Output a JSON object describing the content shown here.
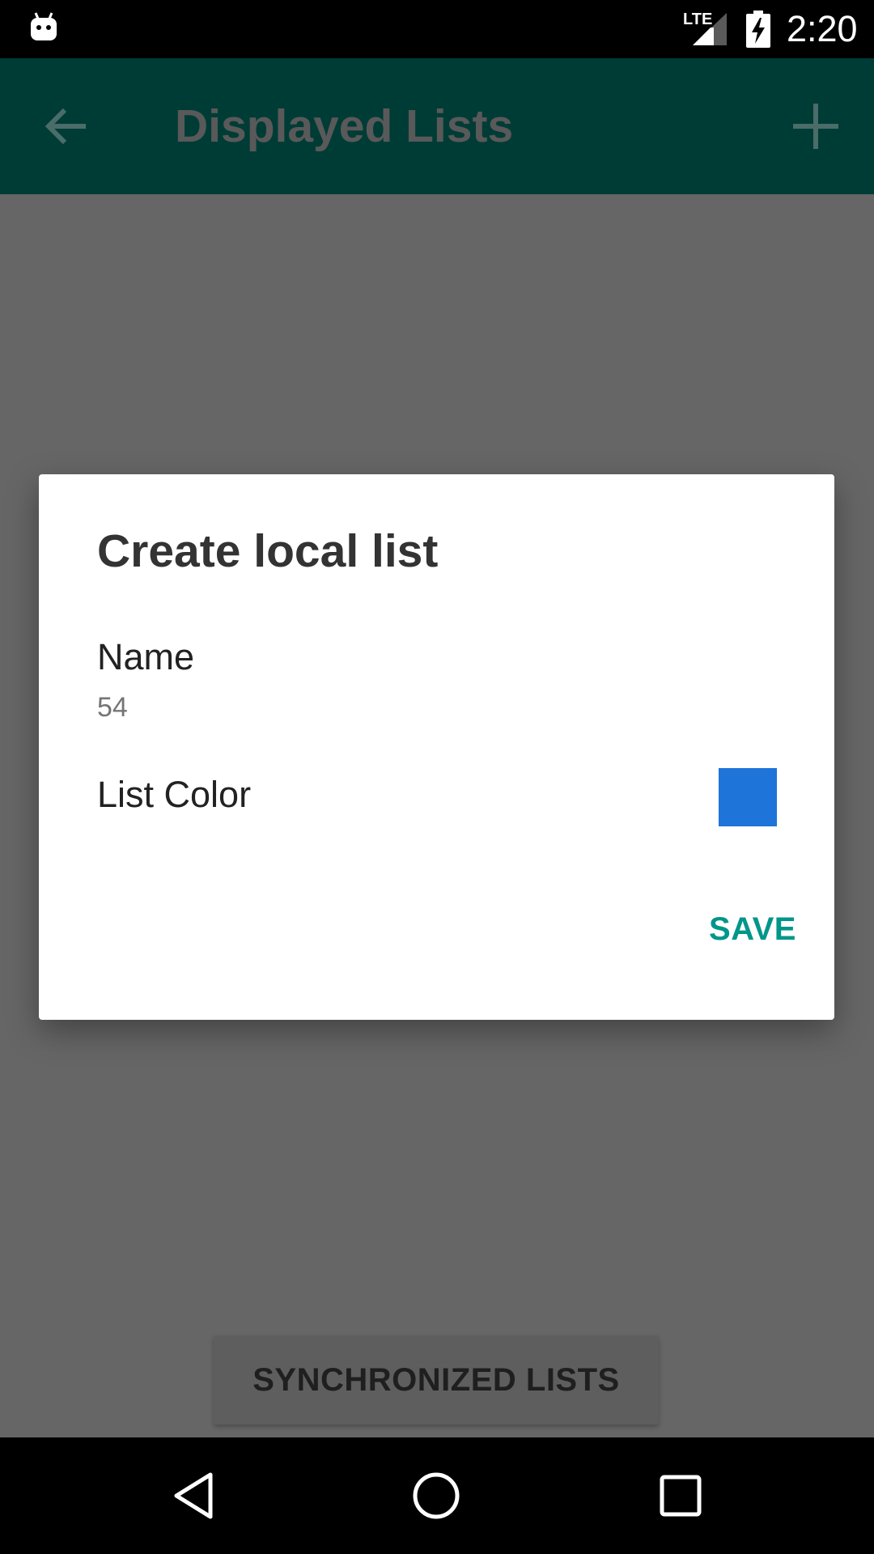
{
  "status_bar": {
    "time": "2:20",
    "network_label": "LTE",
    "icons": [
      "android-icon",
      "lte-signal-icon",
      "battery-charging-icon"
    ]
  },
  "app_bar": {
    "title": "Displayed Lists",
    "back_icon": "arrow-back-icon",
    "add_icon": "add-icon",
    "background_color": "#003c36"
  },
  "dialog": {
    "title": "Create local list",
    "name_label": "Name",
    "name_value": "54",
    "color_label": "List Color",
    "swatch_color": "#1e74d8",
    "save_label": "SAVE",
    "accent_color": "#00968a"
  },
  "bottom_button": {
    "label": "SYNCHRONIZED LISTS"
  },
  "nav_bar": {
    "icons": [
      "back-nav-icon",
      "home-nav-icon",
      "recents-nav-icon"
    ]
  }
}
